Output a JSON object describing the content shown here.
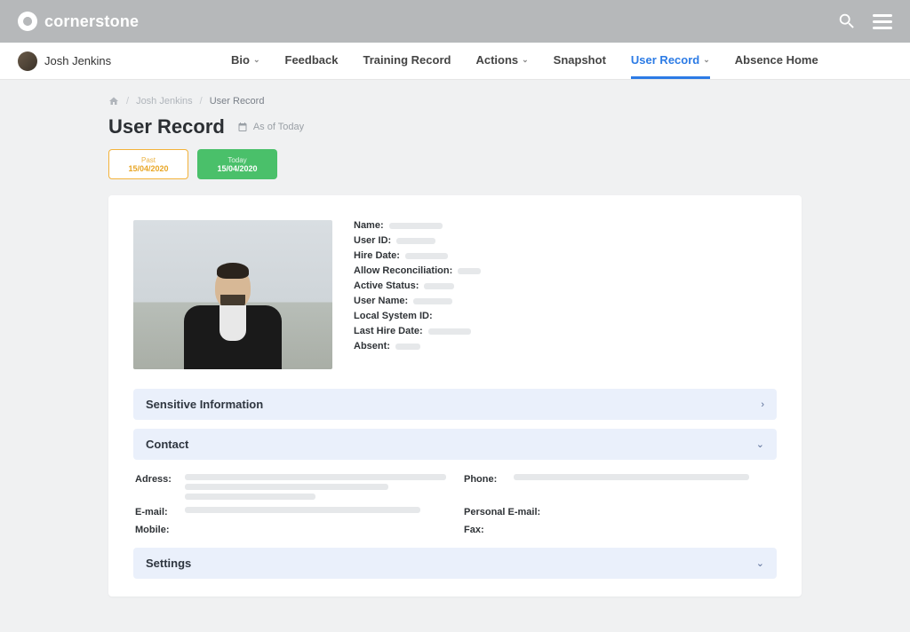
{
  "brand": "cornerstone",
  "user": {
    "name": "Josh Jenkins"
  },
  "nav": {
    "items": [
      {
        "label": "Bio",
        "dropdown": true,
        "active": false
      },
      {
        "label": "Feedback",
        "dropdown": false,
        "active": false
      },
      {
        "label": "Training Record",
        "dropdown": false,
        "active": false
      },
      {
        "label": "Actions",
        "dropdown": true,
        "active": false
      },
      {
        "label": "Snapshot",
        "dropdown": false,
        "active": false
      },
      {
        "label": "User Record",
        "dropdown": true,
        "active": true
      },
      {
        "label": "Absence Home",
        "dropdown": false,
        "active": false
      }
    ]
  },
  "breadcrumb": {
    "home_label": "Home",
    "user": "Josh Jenkins",
    "page": "User Record"
  },
  "page_title": "User Record",
  "as_of_label": "As of Today",
  "date_pills": {
    "past": {
      "label": "Past",
      "date": "15/04/2020"
    },
    "today": {
      "label": "Today",
      "date": "15/04/2020"
    }
  },
  "details": {
    "fields": [
      {
        "label": "Name:",
        "w": 60
      },
      {
        "label": "User ID:",
        "w": 44
      },
      {
        "label": "Hire Date:",
        "w": 48
      },
      {
        "label": "Allow Reconciliation:",
        "w": 26
      },
      {
        "label": "Active Status:",
        "w": 34
      },
      {
        "label": "User Name:",
        "w": 44
      },
      {
        "label": "Local System ID:",
        "w": 0
      },
      {
        "label": "Last Hire Date:",
        "w": 48
      },
      {
        "label": "Absent:",
        "w": 28
      }
    ]
  },
  "sections": {
    "sensitive": "Sensitive Information",
    "contact": "Contact",
    "settings": "Settings"
  },
  "contact": {
    "left": [
      {
        "label": "Adress:",
        "bars": [
          100,
          78,
          50
        ]
      },
      {
        "label": "E-mail:",
        "bars": [
          90
        ]
      },
      {
        "label": "Mobile:",
        "bars": [
          0
        ]
      }
    ],
    "right": [
      {
        "label": "Phone:",
        "bars": [
          90
        ]
      },
      {
        "label": "Personal E-mail:",
        "bars": [
          0
        ]
      },
      {
        "label": "Fax:",
        "bars": [
          0
        ]
      }
    ]
  }
}
